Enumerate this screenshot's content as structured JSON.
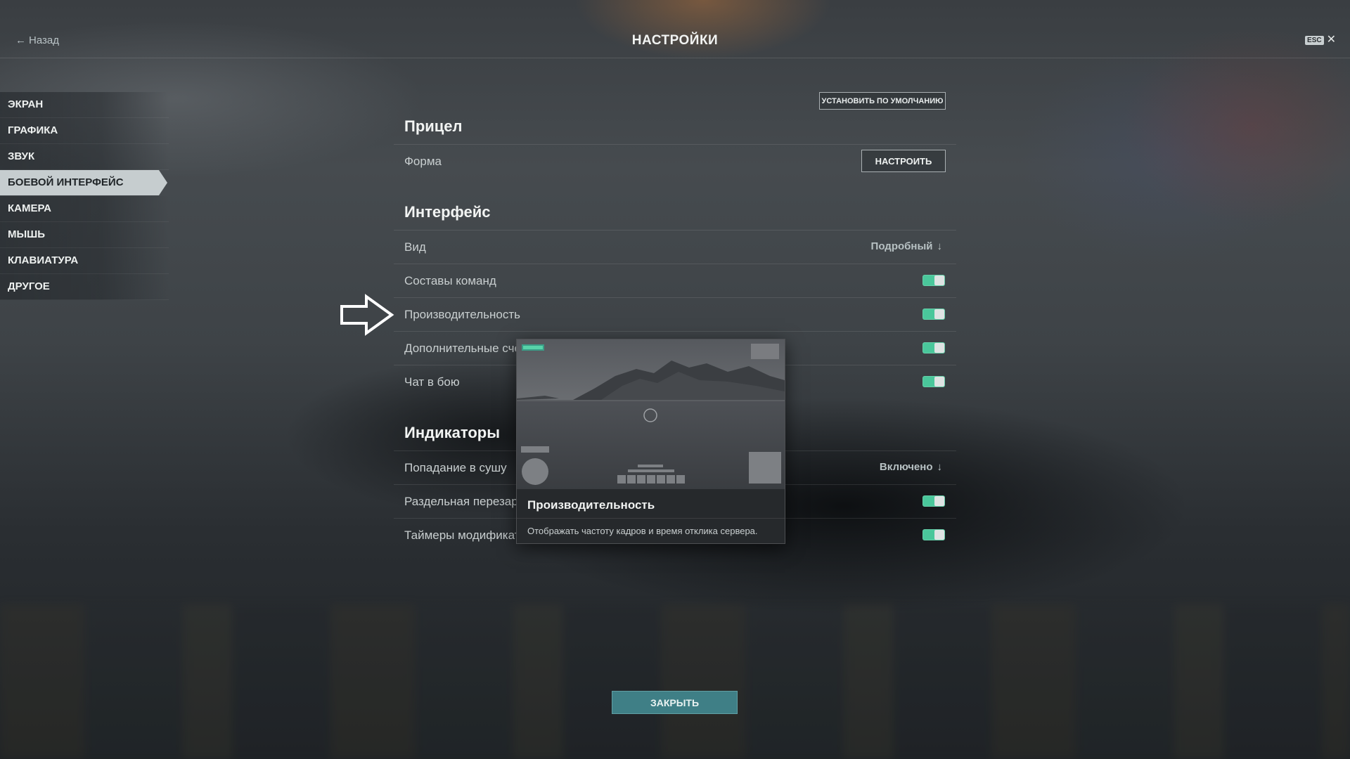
{
  "header": {
    "back_label": "Назад",
    "title": "НАСТРОЙКИ",
    "esc_label": "ESC",
    "close_glyph": "✕"
  },
  "sidebar": {
    "items": [
      {
        "label": "ЭКРАН"
      },
      {
        "label": "ГРАФИКА"
      },
      {
        "label": "ЗВУК"
      },
      {
        "label": "БОЕВОЙ ИНТЕРФЕЙС",
        "active": true
      },
      {
        "label": "КАМЕРА"
      },
      {
        "label": "МЫШЬ"
      },
      {
        "label": "КЛАВИАТУРА"
      },
      {
        "label": "ДРУГОЕ"
      }
    ]
  },
  "main": {
    "default_button": "УСТАНОВИТЬ ПО УМОЛЧАНИЮ",
    "sections": {
      "sight": {
        "title": "Прицел",
        "rows": [
          {
            "label": "Форма",
            "button": "НАСТРОИТЬ"
          }
        ]
      },
      "interface": {
        "title": "Интерфейс",
        "rows": [
          {
            "label": "Вид",
            "value": "Подробный"
          },
          {
            "label": "Составы команд",
            "toggle": true
          },
          {
            "label": "Производительность",
            "toggle": true
          },
          {
            "label": "Дополнительные счё",
            "toggle": true
          },
          {
            "label": "Чат в бою",
            "toggle": true
          }
        ]
      },
      "indicators": {
        "title": "Индикаторы",
        "rows": [
          {
            "label": "Попадание в сушу",
            "value": "Включено"
          },
          {
            "label": "Раздельная перезаря",
            "toggle": true
          },
          {
            "label": "Таймеры модификат",
            "toggle": true
          }
        ]
      }
    }
  },
  "tooltip": {
    "title": "Производительность",
    "description": "Отображать частоту кадров и время отклика сервера."
  },
  "footer": {
    "close_button": "ЗАКРЫТЬ"
  },
  "colors": {
    "toggle_on": "#4ac79b",
    "close_button_bg": "#3f7f86",
    "active_tab_bg": "#c6cdcf"
  }
}
